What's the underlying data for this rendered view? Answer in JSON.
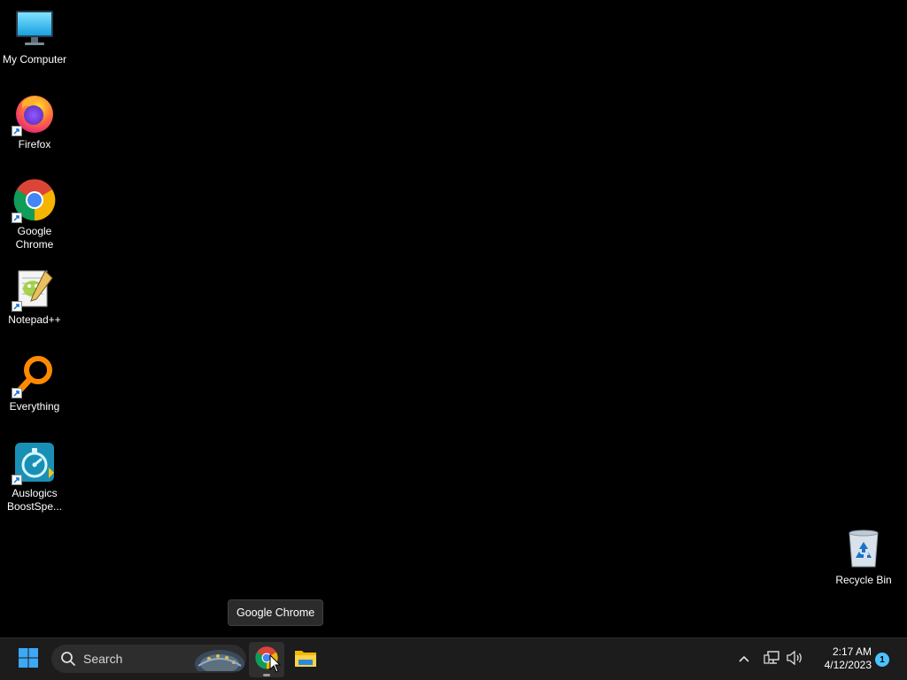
{
  "desktop": {
    "icons": [
      {
        "label": "My Computer",
        "icon": "monitor-icon",
        "shortcut": false
      },
      {
        "label": "Firefox",
        "icon": "firefox-icon",
        "shortcut": true
      },
      {
        "label": "Google\nChrome",
        "icon": "chrome-icon",
        "shortcut": true
      },
      {
        "label": "Notepad++",
        "icon": "notepadpp-icon",
        "shortcut": true
      },
      {
        "label": "Everything",
        "icon": "everything-icon",
        "shortcut": true
      },
      {
        "label": "Auslogics\nBoostSpe...",
        "icon": "auslogics-boostspeed-icon",
        "shortcut": true
      }
    ],
    "recycle_bin": {
      "label": "Recycle Bin",
      "icon": "recycle-bin-icon"
    }
  },
  "tooltip": {
    "text": "Google Chrome"
  },
  "taskbar": {
    "start": {
      "icon": "windows-start-icon"
    },
    "search": {
      "placeholder": "Search",
      "icon": "search-icon"
    },
    "apps": [
      {
        "name": "Google Chrome",
        "icon": "chrome-icon",
        "active": true
      },
      {
        "name": "File Explorer",
        "icon": "file-explorer-icon",
        "active": false
      }
    ],
    "tray": {
      "overflow_icon": "chevron-up-icon",
      "network_icon": "network-icon",
      "volume_icon": "speaker-icon",
      "time": "2:17 AM",
      "date": "4/12/2023",
      "notification_count": "1"
    }
  },
  "colors": {
    "desktop_bg": "#000000",
    "taskbar_bg": "#1c1c1c",
    "accent": "#4cc2ff"
  }
}
